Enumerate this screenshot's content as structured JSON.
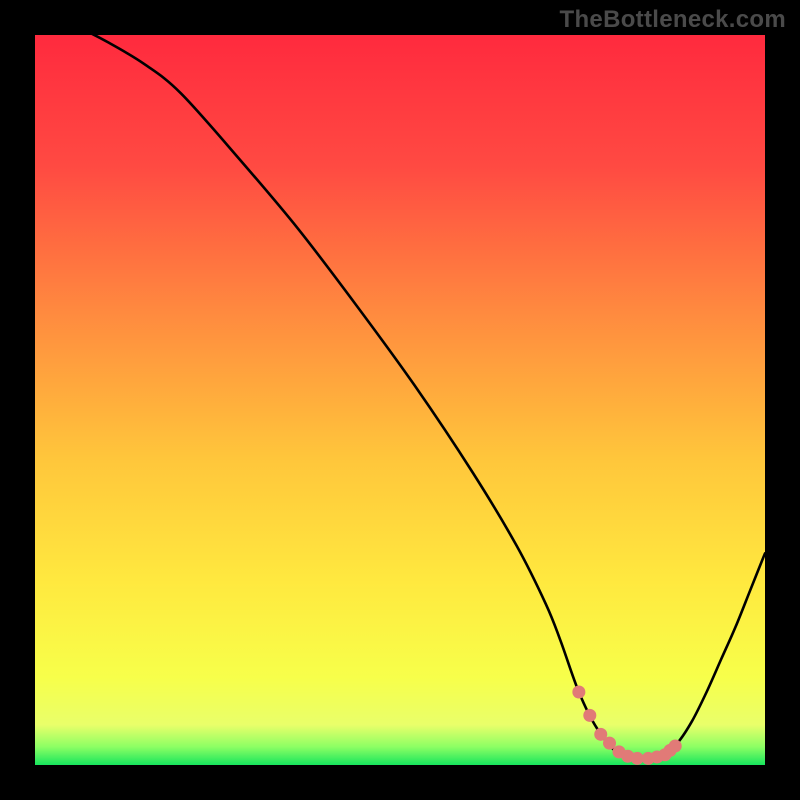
{
  "watermark": "TheBottleneck.com",
  "chart_data": {
    "type": "line",
    "title": "",
    "xlabel": "",
    "ylabel": "",
    "xlim": [
      0,
      100
    ],
    "ylim": [
      0,
      100
    ],
    "grid": false,
    "series": [
      {
        "name": "bottleneck-curve",
        "x": [
          0,
          3,
          6,
          10,
          15,
          20,
          28,
          36,
          44,
          52,
          60,
          66,
          70,
          72,
          74.5,
          77,
          80,
          83,
          86,
          88,
          90,
          92,
          94,
          96,
          98,
          100
        ],
        "values": [
          103,
          102,
          101,
          99,
          96,
          92,
          83,
          73.5,
          63,
          52,
          40,
          30,
          22,
          17,
          10,
          5,
          1.5,
          0.8,
          1.3,
          3,
          6,
          10,
          14.5,
          19,
          24,
          29
        ]
      }
    ],
    "markers": {
      "name": "optimal-zone-dots",
      "color": "#e17a77",
      "x": [
        74.5,
        76,
        77.5,
        78.7,
        80,
        81.2,
        82.5,
        84,
        85.2,
        86.3,
        87,
        87.7
      ],
      "values": [
        10,
        6.8,
        4.2,
        3.0,
        1.8,
        1.2,
        0.9,
        0.9,
        1.1,
        1.4,
        2.0,
        2.6
      ]
    },
    "gradient": {
      "type": "vertical",
      "stops": [
        {
          "pos": 0.0,
          "color": "#ff2a3e"
        },
        {
          "pos": 0.18,
          "color": "#ff4a42"
        },
        {
          "pos": 0.38,
          "color": "#ff8a3f"
        },
        {
          "pos": 0.58,
          "color": "#ffc63b"
        },
        {
          "pos": 0.75,
          "color": "#ffe93f"
        },
        {
          "pos": 0.88,
          "color": "#f7ff4a"
        },
        {
          "pos": 0.945,
          "color": "#e9ff6a"
        },
        {
          "pos": 0.975,
          "color": "#8dff64"
        },
        {
          "pos": 1.0,
          "color": "#17e55d"
        }
      ]
    },
    "curve_stroke": "#000000",
    "curve_width": 2.6,
    "marker_radius": 6.5
  }
}
